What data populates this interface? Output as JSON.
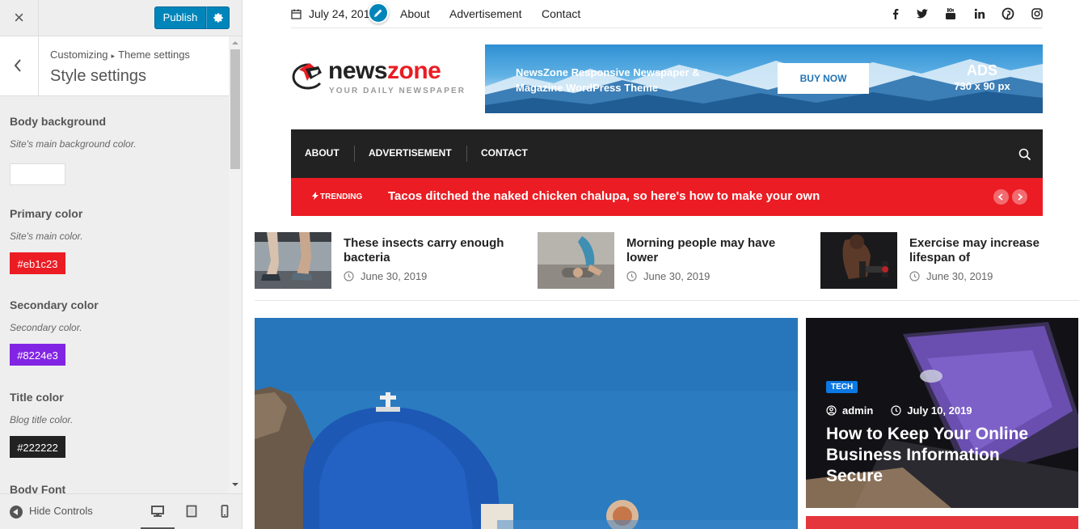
{
  "customizer": {
    "close_label": "×",
    "publish_label": "Publish",
    "breadcrumb_root": "Customizing",
    "breadcrumb_sep": "▸",
    "breadcrumb_parent": "Theme settings",
    "section_title": "Style settings",
    "controls": [
      {
        "label": "Body background",
        "description": "Site's main background color.",
        "value": "",
        "color": "#ffffff"
      },
      {
        "label": "Primary color",
        "description": "Site's main color.",
        "value": "#eb1c23",
        "color": "#eb1c23"
      },
      {
        "label": "Secondary color",
        "description": "Secondary color.",
        "value": "#8224e3",
        "color": "#8224e3"
      },
      {
        "label": "Title color",
        "description": "Blog title color.",
        "value": "#222222",
        "color": "#222222"
      },
      {
        "label": "Body Font"
      }
    ],
    "hide_controls_label": "Hide Controls",
    "devices": [
      "desktop-icon",
      "tablet-icon",
      "mobile-icon"
    ]
  },
  "site": {
    "topbar": {
      "date": "July 24, 2019",
      "links": [
        "About",
        "Advertisement",
        "Contact"
      ],
      "social": [
        "facebook-icon",
        "twitter-icon",
        "youtube-icon",
        "linkedin-icon",
        "pinterest-icon",
        "instagram-icon"
      ]
    },
    "logo": {
      "part1": "news",
      "part2": "zone",
      "tagline": "YOUR DAILY NEWSPAPER"
    },
    "ad": {
      "text": "NewsZone Responsive Newspaper & Magazine WordPress Theme",
      "button": "BUY NOW",
      "title": "ADS",
      "size": "730 x 90 px"
    },
    "nav": [
      "ABOUT",
      "ADVERTISEMENT",
      "CONTACT"
    ],
    "trending": {
      "label": "TRENDING",
      "headline": "Tacos ditched the naked chicken chalupa, so here's how to make your own"
    },
    "small_posts": [
      {
        "title": "These insects carry enough bacteria",
        "date": "June 30, 2019"
      },
      {
        "title": "Morning people may have lower",
        "date": "June 30, 2019"
      },
      {
        "title": "Exercise may increase lifespan of",
        "date": "June 30, 2019"
      }
    ],
    "side_post": {
      "category": "TECH",
      "author": "admin",
      "date": "July 10, 2019",
      "title": "How to Keep Your Online Business Information Secure"
    },
    "colors": {
      "primary": "#eb1c23",
      "nav_bg": "#222222",
      "wp_blue": "#0085ba"
    }
  }
}
